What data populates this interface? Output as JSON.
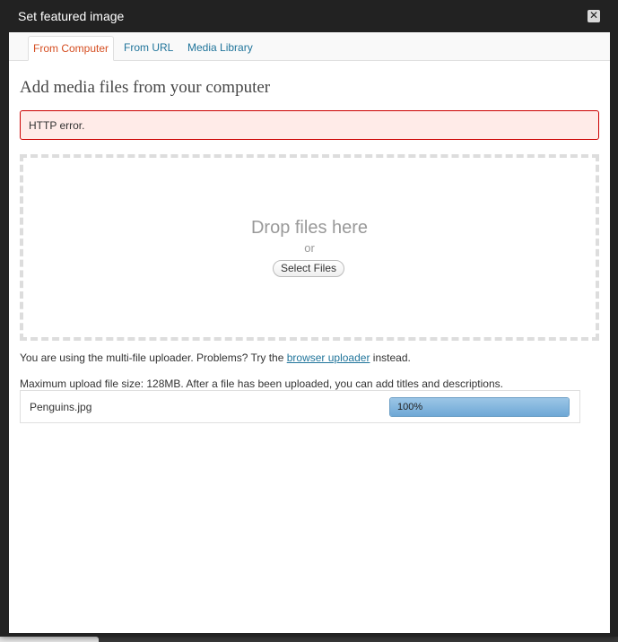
{
  "dialog": {
    "title": "Set featured image",
    "close_glyph": "✕"
  },
  "tabs": [
    {
      "label": "From Computer",
      "active": true
    },
    {
      "label": "From URL",
      "active": false
    },
    {
      "label": "Media Library",
      "active": false
    }
  ],
  "main": {
    "heading": "Add media files from your computer",
    "error": "HTTP error.",
    "dropzone": {
      "drop_text": "Drop files here",
      "or_text": "or",
      "select_button": "Select Files"
    },
    "uploader_note": {
      "prefix": "You are using the multi-file uploader. Problems? Try the",
      "link": "browser uploader",
      "suffix": "instead."
    },
    "max_note": "Maximum upload file size: 128MB. After a file has been uploaded, you can add titles and descriptions.",
    "file": {
      "name": "Penguins.jpg",
      "progress_label": "100%",
      "progress_value": 100
    }
  },
  "colors": {
    "accent": "#21759b",
    "active_tab": "#d54e21",
    "error_bg": "#ffebe8",
    "error_border": "#cc0000"
  },
  "icons": {
    "close": "close-icon"
  }
}
